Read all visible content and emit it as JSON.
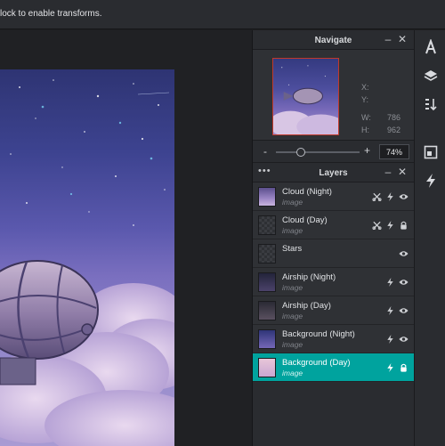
{
  "topbar": {
    "hint": "lock to enable transforms."
  },
  "navigate": {
    "title": "Navigate",
    "x_label": "X:",
    "y_label": "Y:",
    "x_value": "",
    "y_value": "",
    "w_label": "W:",
    "h_label": "H:",
    "w_value": "786",
    "h_value": "962"
  },
  "zoom": {
    "value": "74%",
    "minus": "-",
    "plus": "+",
    "level": 0.3
  },
  "layers": {
    "title": "Layers",
    "items": [
      {
        "name": "Cloud (Night)",
        "type": "image",
        "thumb": "cloud-night",
        "icons": [
          "crop-icon",
          "bolt-icon",
          "eye-icon"
        ],
        "active": false
      },
      {
        "name": "Cloud (Day)",
        "type": "image",
        "thumb": "cloud-day",
        "icons": [
          "crop-icon",
          "bolt-icon",
          "lock-icon"
        ],
        "active": false
      },
      {
        "name": "Stars",
        "type": "",
        "thumb": "transparent",
        "icons": [
          "eye-icon"
        ],
        "active": false
      },
      {
        "name": "Airship (Night)",
        "type": "image",
        "thumb": "airship-night",
        "icons": [
          "bolt-icon",
          "eye-icon"
        ],
        "active": false
      },
      {
        "name": "Airship (Day)",
        "type": "image",
        "thumb": "airship-day",
        "icons": [
          "bolt-icon",
          "eye-icon"
        ],
        "active": false
      },
      {
        "name": "Background (Night)",
        "type": "image",
        "thumb": "bg-night",
        "icons": [
          "bolt-icon",
          "eye-icon"
        ],
        "active": false
      },
      {
        "name": "Background (Day)",
        "type": "image",
        "thumb": "bg-day",
        "icons": [
          "bolt-icon",
          "lock-icon"
        ],
        "active": true
      }
    ]
  },
  "toolbar": {
    "tools": [
      "text-tool-icon",
      "layers-stack-icon",
      "sort-icon",
      "transform-icon",
      "filter-bolt-icon"
    ]
  },
  "colors": {
    "accent": "#00a39e",
    "panel": "#2a2c30",
    "nav_frame": "#c0392b"
  }
}
